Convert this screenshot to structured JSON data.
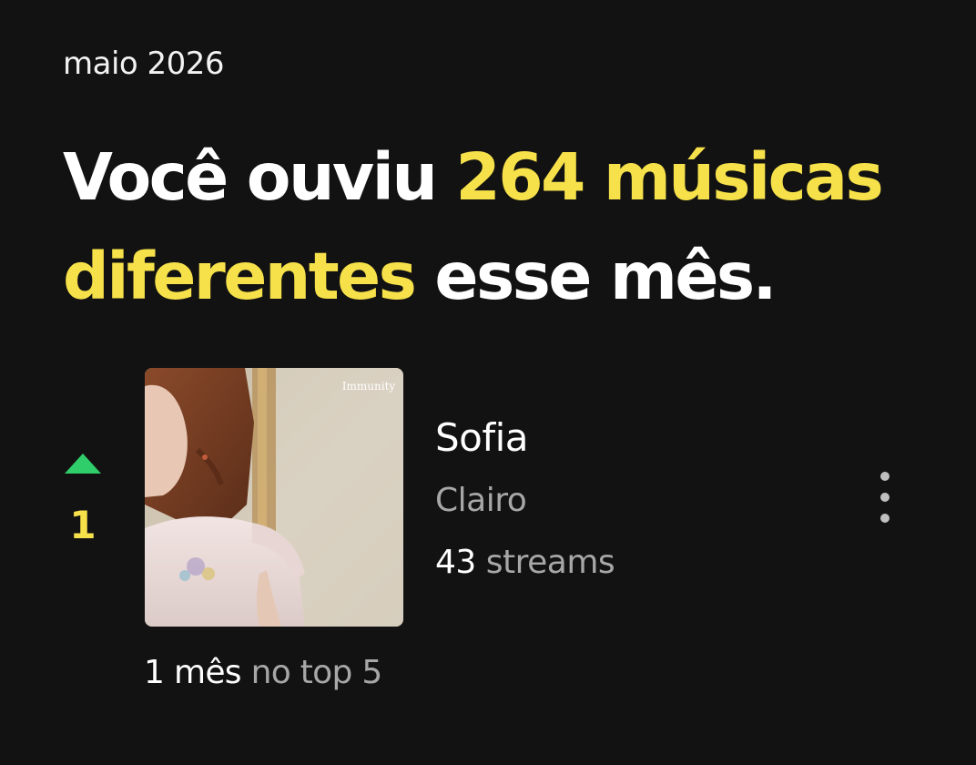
{
  "period": "maio 2026",
  "headline": {
    "prefix": "Você ouviu ",
    "highlight": "264 músicas diferentes",
    "suffix": " esse mês."
  },
  "track": {
    "rank": "1",
    "rank_trend": "up",
    "title": "Sofia",
    "artist": "Clairo",
    "streams_count": "43",
    "streams_label": "streams",
    "cover_label": "Immunity",
    "months_in_top_value": "1 mês",
    "months_in_top_label": "no top 5"
  },
  "colors": {
    "background": "#121212",
    "highlight": "#f7e14a",
    "trend_up": "#2fce6a",
    "secondary_text": "#a7a7a7"
  },
  "icons": {
    "trend": "triangle-up-icon",
    "menu": "more-vertical-icon"
  }
}
